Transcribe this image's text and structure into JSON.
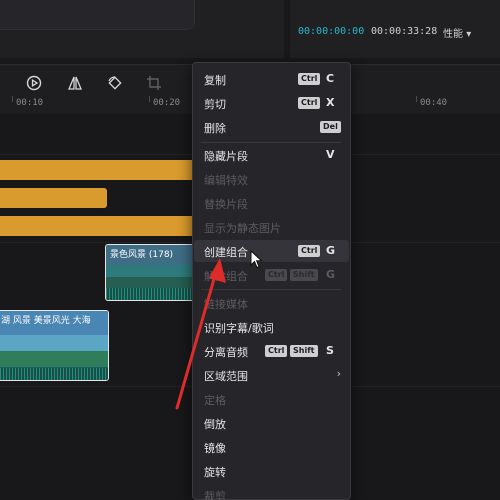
{
  "player": {
    "time_current": "00:00:00:00",
    "time_total": "00:00:33:28",
    "performance_label": "性能"
  },
  "toolbar": {
    "icons": [
      "play-circle-icon",
      "mirror-icon",
      "rotate-icon",
      "crop-icon"
    ]
  },
  "ruler": {
    "ticks": [
      "00:10",
      "00:20",
      "00:40"
    ]
  },
  "timeline": {
    "clip1_title": "景色风景 (178)",
    "clip2_title": "湖 风景 美景风光  大海"
  },
  "menu": {
    "copy": {
      "label": "复制",
      "mod": "Ctrl",
      "key": "C"
    },
    "cut": {
      "label": "剪切",
      "mod": "Ctrl",
      "key": "X"
    },
    "delete": {
      "label": "删除",
      "mod": "Del"
    },
    "hide_clip": {
      "label": "隐藏片段",
      "key": "V"
    },
    "edit_effect": {
      "label": "编辑特效"
    },
    "replace_clip": {
      "label": "替换片段"
    },
    "show_as_still": {
      "label": "显示为静态图片"
    },
    "create_group": {
      "label": "创建组合",
      "mod": "Ctrl",
      "key": "G"
    },
    "ungroup": {
      "label": "解除组合",
      "mod1": "Ctrl",
      "mod2": "Shift",
      "key": "G"
    },
    "link_media": {
      "label": "链接媒体"
    },
    "recognize_subtitles": {
      "label": "识别字幕/歌词"
    },
    "separate_audio": {
      "label": "分离音频",
      "mod1": "Ctrl",
      "mod2": "Shift",
      "key": "S"
    },
    "region_range": {
      "label": "区域范围",
      "arrow": "›"
    },
    "freeze": {
      "label": "定格"
    },
    "reverse": {
      "label": "倒放"
    },
    "mirror": {
      "label": "镜像"
    },
    "rotate": {
      "label": "旋转"
    },
    "crop": {
      "label": "裁剪"
    }
  },
  "colors": {
    "accent": "#29b6c6",
    "track_bar": "#d99a2e",
    "annotation_arrow": "#e02b2b"
  }
}
